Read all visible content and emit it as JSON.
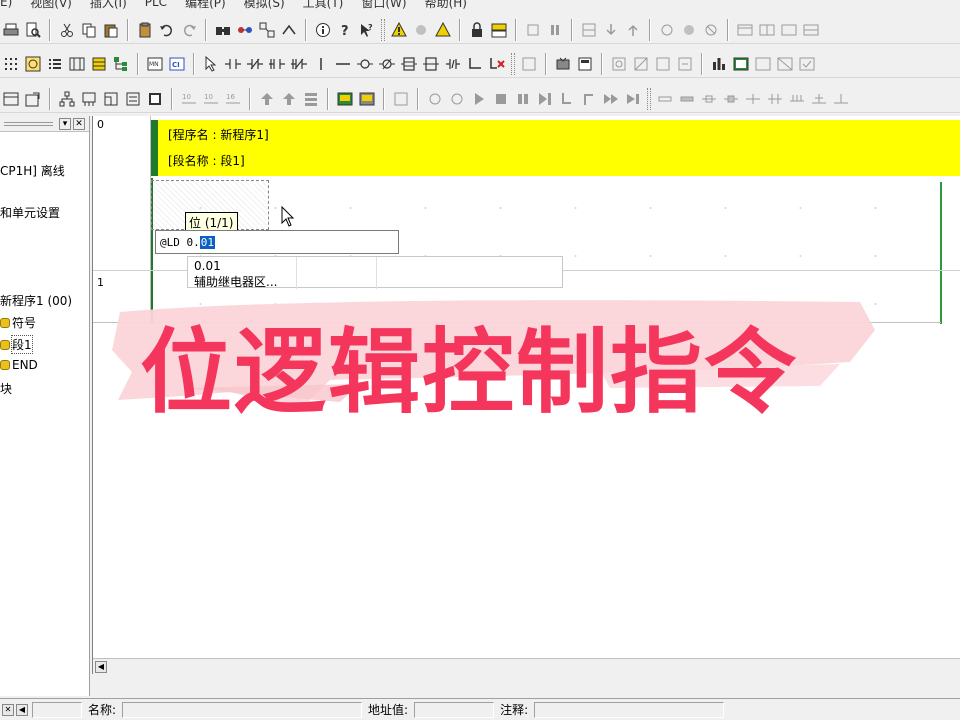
{
  "menu": [
    "E)",
    "视图(V)",
    "插入(I)",
    "PLC",
    "编程(P)",
    "模拟(S)",
    "工具(T)",
    "窗口(W)",
    "帮助(H)"
  ],
  "tree": {
    "items": [
      {
        "label": "CP1H] 离线",
        "icon": false
      },
      {
        "label": "和单元设置",
        "icon": false
      },
      {
        "label": "新程序1 (00)",
        "icon": false
      },
      {
        "label": "符号",
        "icon": true
      },
      {
        "label": "段1",
        "icon": true,
        "selected": true
      },
      {
        "label": "END",
        "icon": true
      },
      {
        "label": "块",
        "icon": false
      }
    ]
  },
  "ladder": {
    "rung0": "0",
    "rung1": "1",
    "program_name": "[程序名 : 新程序1]",
    "section_name": "[段名称 : 段1]",
    "tooltip": "位 (1/1)",
    "command_prefix": "@LD 0.",
    "command_selected": "01",
    "suggest_value": "0.01",
    "suggest_desc": "辅助继电器区..."
  },
  "status": {
    "name_label": "名称:",
    "address_label": "地址值:",
    "comment_label": "注释:"
  },
  "overlay": {
    "title": "位逻辑控制指令",
    "color": "#f5365c"
  },
  "colors": {
    "banner": "#ffff00",
    "rail": "#1f7a2e",
    "selection": "#0a5fc2"
  }
}
